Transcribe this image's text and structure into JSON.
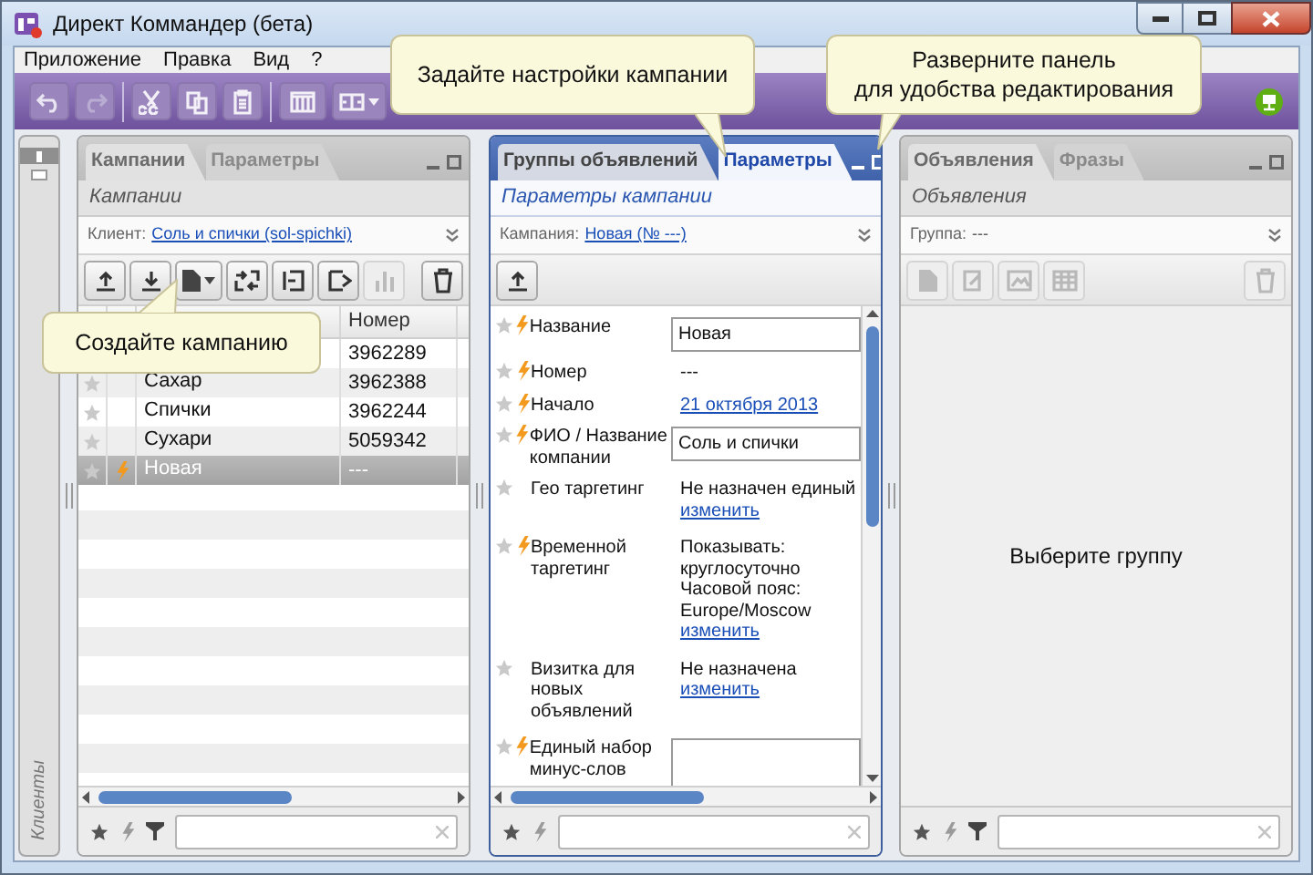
{
  "window": {
    "title": "Директ Коммандер (бета)"
  },
  "menu": [
    "Приложение",
    "Правка",
    "Вид",
    "?"
  ],
  "sidebar": {
    "label": "Клиенты"
  },
  "panels": [
    {
      "kind": "table",
      "active": false,
      "tabs": [
        {
          "label": "Кампании",
          "selected": true
        },
        {
          "label": "Параметры",
          "selected": false
        }
      ],
      "subtitle": "Кампании",
      "context": {
        "label": "Клиент:",
        "value": "Соль и спички (sol-spichki)",
        "link": true
      },
      "table": {
        "columns": [
          "Номер"
        ],
        "rows": [
          {
            "number": "3962289",
            "selected": false
          },
          {
            "name": "Сахар",
            "number": "3962388",
            "modified": false,
            "selected": false
          },
          {
            "name": "Спички",
            "number": "3962244",
            "modified": false,
            "selected": false
          },
          {
            "name": "Сухари",
            "number": "5059342",
            "modified": false,
            "selected": false
          },
          {
            "name": "Новая",
            "number": "---",
            "modified": true,
            "selected": true
          }
        ]
      },
      "footer": {
        "filter": true
      }
    },
    {
      "kind": "form",
      "active": true,
      "tabs": [
        {
          "label": "Группы объявлений",
          "selected": false
        },
        {
          "label": "Параметры",
          "selected": true
        }
      ],
      "subtitle": "Параметры кампании",
      "context": {
        "label": "Кампания:",
        "value": "Новая (№ ---)",
        "link": true
      },
      "fields": [
        {
          "kind": "input",
          "label": "Название",
          "modified": true,
          "value": "Новая"
        },
        {
          "kind": "text",
          "label": "Номер",
          "modified": true,
          "lines": [
            "---"
          ]
        },
        {
          "kind": "link",
          "label": "Начало",
          "modified": true,
          "value": "21 октября 2013"
        },
        {
          "kind": "input",
          "label": "ФИО / Название компании",
          "modified": true,
          "value": "Соль и спички"
        },
        {
          "kind": "text",
          "label": "Гео таргетинг",
          "modified": false,
          "lines": [
            "Не назначен единый"
          ],
          "action": "изменить"
        },
        {
          "kind": "text",
          "label": "Временной таргетинг",
          "modified": true,
          "lines": [
            "Показывать:",
            "круглосуточно",
            "Часовой пояс:",
            "Europe/Moscow"
          ],
          "action": "изменить"
        },
        {
          "kind": "text",
          "label": "Визитка для новых объявлений",
          "modified": false,
          "lines": [
            "Не назначена"
          ],
          "action": "изменить"
        },
        {
          "kind": "textarea",
          "label": "Единый набор минус-слов",
          "modified": true
        }
      ],
      "footer": {
        "filter": false
      }
    },
    {
      "kind": "empty",
      "active": false,
      "tabs": [
        {
          "label": "Объявления",
          "selected": true
        },
        {
          "label": "Фразы",
          "selected": false
        }
      ],
      "subtitle": "Объявления",
      "context": {
        "label": "Группа:",
        "value": "---",
        "link": false
      },
      "message": "Выберите группу",
      "footer": {
        "filter": true
      }
    }
  ],
  "callouts": [
    {
      "text": "Задайте настройки кампании"
    },
    {
      "text": "Разверните панель\nдля удобства редактирования"
    },
    {
      "text": "Создайте кампанию"
    }
  ]
}
